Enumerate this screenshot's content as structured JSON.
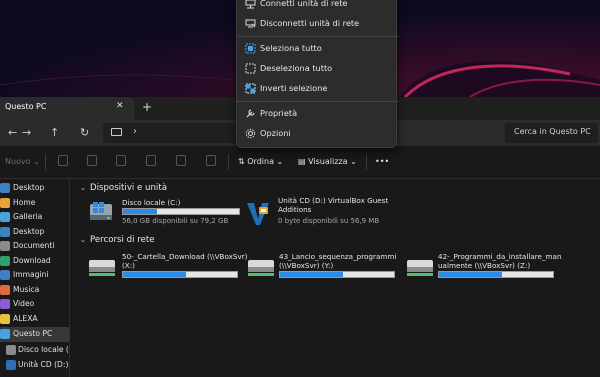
{
  "window": {
    "tab_title": "Questo PC",
    "close_glyph": "✕",
    "newtab_glyph": "+"
  },
  "nav": {
    "back": "←",
    "forward": "→",
    "up": "↑",
    "refresh": "↻",
    "chevron": "›"
  },
  "search": {
    "placeholder": "Cerca in Questo PC"
  },
  "cmdbar": {
    "new": "Nuovo",
    "sort": "Ordina",
    "view": "Visualizza",
    "more": "•••",
    "dropdown": "⌄"
  },
  "sidebar": {
    "items": [
      {
        "label": "Desktop",
        "icon": "desktop-icon",
        "color": "#3b82c4"
      },
      {
        "label": "Home",
        "icon": "home-icon",
        "color": "#e8a33d"
      },
      {
        "label": "Galleria",
        "icon": "gallery-icon",
        "color": "#4aa3df"
      },
      {
        "label": "Desktop",
        "icon": "desktop-icon",
        "color": "#3b82c4"
      },
      {
        "label": "Documenti",
        "icon": "documents-icon",
        "color": "#8a8a8a"
      },
      {
        "label": "Download",
        "icon": "download-icon",
        "color": "#2f9e6e"
      },
      {
        "label": "Immagini",
        "icon": "pictures-icon",
        "color": "#3b82c4"
      },
      {
        "label": "Musica",
        "icon": "music-icon",
        "color": "#e06a3b"
      },
      {
        "label": "Video",
        "icon": "video-icon",
        "color": "#8e5bd8"
      },
      {
        "label": "ALEXA",
        "icon": "folder-icon",
        "color": "#e8c23d"
      },
      {
        "label": "Questo PC",
        "icon": "pc-icon",
        "color": "#4aa3df"
      },
      {
        "label": "Disco locale (C",
        "icon": "drive-icon",
        "color": "#8a8a8a"
      },
      {
        "label": "Unità CD (D:) V",
        "icon": "cd-drive-icon",
        "color": "#2d6fb7"
      }
    ]
  },
  "sections": {
    "devices": {
      "title": "Dispositivi e unità",
      "caret": "⌄"
    },
    "network": {
      "title": "Percorsi di rete",
      "caret": "⌄"
    }
  },
  "drives": [
    {
      "name": "Disco locale (C:)",
      "space": "56,0 GB disponibili su 79,2 GB",
      "used_pct": 29
    },
    {
      "name_line1": "Unità CD (D:) VirtualBox Guest",
      "name_line2": "Additions",
      "space": "0 byte disponibili su 56,9 MB"
    }
  ],
  "network": [
    {
      "line1": "50-_Cartella_Download (\\\\VBoxSvr)",
      "line2": "(X:)",
      "used_pct": 55
    },
    {
      "line1": "43_Lancio_sequenza_programmi",
      "line2": "(\\\\VBoxSvr) (Y:)",
      "used_pct": 55
    },
    {
      "line1": "42-_Programmi_da_installare_man",
      "line2": "ualmente (\\\\VBoxSvr) (Z:)",
      "used_pct": 55
    }
  ],
  "menu": {
    "items": [
      {
        "label": "Connetti unità di rete",
        "icon": "network-drive-icon"
      },
      {
        "label": "Disconnetti unità di rete",
        "icon": "disconnect-network-icon"
      },
      {
        "label": "Seleziona tutto",
        "icon": "select-all-icon"
      },
      {
        "label": "Deseleziona tutto",
        "icon": "deselect-all-icon"
      },
      {
        "label": "Inverti selezione",
        "icon": "invert-selection-icon"
      },
      {
        "label": "Proprietà",
        "icon": "properties-icon"
      },
      {
        "label": "Opzioni",
        "icon": "options-icon"
      }
    ]
  }
}
